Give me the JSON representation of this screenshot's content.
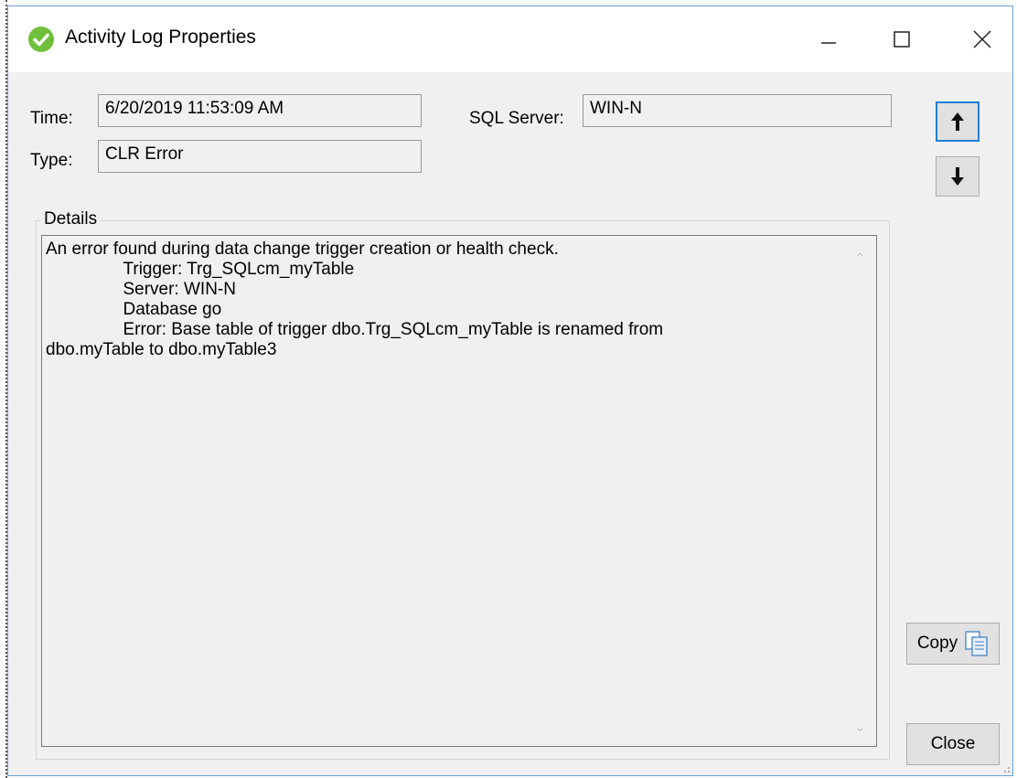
{
  "window": {
    "title": "Activity Log Properties",
    "icon": "green-check-icon",
    "controls": [
      "minimize-icon",
      "maximize-icon",
      "close-icon"
    ]
  },
  "fields": {
    "time_label": "Time:",
    "time_value": "6/20/2019 11:53:09 AM",
    "type_label": "Type:",
    "type_value": "CLR Error",
    "server_label": "SQL Server:",
    "server_value": "WIN-N"
  },
  "nav": {
    "up_icon": "arrow-up-icon",
    "down_icon": "arrow-down-icon"
  },
  "details": {
    "group_label": "Details",
    "text": "An error found during data change trigger creation or health check.\n                Trigger: Trg_SQLcm_myTable\n                Server: WIN-N\n                Database go\n                Error: Base table of trigger dbo.Trg_SQLcm_myTable is renamed from\ndbo.myTable to dbo.myTable3"
  },
  "buttons": {
    "copy": "Copy",
    "close": "Close"
  },
  "colors": {
    "accent": "#1f7fd6",
    "icon_green": "#6fbf3a",
    "window_bg": "#f0f0f0"
  }
}
